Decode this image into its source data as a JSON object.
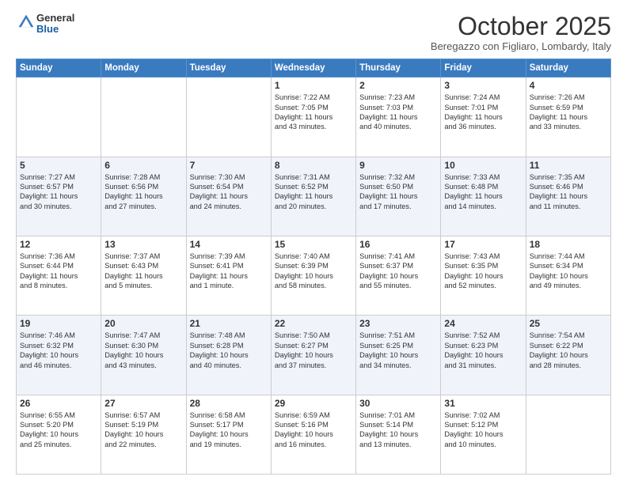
{
  "header": {
    "logo_line1": "General",
    "logo_line2": "Blue",
    "month": "October 2025",
    "location": "Beregazzo con Figliaro, Lombardy, Italy"
  },
  "weekdays": [
    "Sunday",
    "Monday",
    "Tuesday",
    "Wednesday",
    "Thursday",
    "Friday",
    "Saturday"
  ],
  "weeks": [
    [
      {
        "day": "",
        "info": ""
      },
      {
        "day": "",
        "info": ""
      },
      {
        "day": "",
        "info": ""
      },
      {
        "day": "1",
        "info": "Sunrise: 7:22 AM\nSunset: 7:05 PM\nDaylight: 11 hours\nand 43 minutes."
      },
      {
        "day": "2",
        "info": "Sunrise: 7:23 AM\nSunset: 7:03 PM\nDaylight: 11 hours\nand 40 minutes."
      },
      {
        "day": "3",
        "info": "Sunrise: 7:24 AM\nSunset: 7:01 PM\nDaylight: 11 hours\nand 36 minutes."
      },
      {
        "day": "4",
        "info": "Sunrise: 7:26 AM\nSunset: 6:59 PM\nDaylight: 11 hours\nand 33 minutes."
      }
    ],
    [
      {
        "day": "5",
        "info": "Sunrise: 7:27 AM\nSunset: 6:57 PM\nDaylight: 11 hours\nand 30 minutes."
      },
      {
        "day": "6",
        "info": "Sunrise: 7:28 AM\nSunset: 6:56 PM\nDaylight: 11 hours\nand 27 minutes."
      },
      {
        "day": "7",
        "info": "Sunrise: 7:30 AM\nSunset: 6:54 PM\nDaylight: 11 hours\nand 24 minutes."
      },
      {
        "day": "8",
        "info": "Sunrise: 7:31 AM\nSunset: 6:52 PM\nDaylight: 11 hours\nand 20 minutes."
      },
      {
        "day": "9",
        "info": "Sunrise: 7:32 AM\nSunset: 6:50 PM\nDaylight: 11 hours\nand 17 minutes."
      },
      {
        "day": "10",
        "info": "Sunrise: 7:33 AM\nSunset: 6:48 PM\nDaylight: 11 hours\nand 14 minutes."
      },
      {
        "day": "11",
        "info": "Sunrise: 7:35 AM\nSunset: 6:46 PM\nDaylight: 11 hours\nand 11 minutes."
      }
    ],
    [
      {
        "day": "12",
        "info": "Sunrise: 7:36 AM\nSunset: 6:44 PM\nDaylight: 11 hours\nand 8 minutes."
      },
      {
        "day": "13",
        "info": "Sunrise: 7:37 AM\nSunset: 6:43 PM\nDaylight: 11 hours\nand 5 minutes."
      },
      {
        "day": "14",
        "info": "Sunrise: 7:39 AM\nSunset: 6:41 PM\nDaylight: 11 hours\nand 1 minute."
      },
      {
        "day": "15",
        "info": "Sunrise: 7:40 AM\nSunset: 6:39 PM\nDaylight: 10 hours\nand 58 minutes."
      },
      {
        "day": "16",
        "info": "Sunrise: 7:41 AM\nSunset: 6:37 PM\nDaylight: 10 hours\nand 55 minutes."
      },
      {
        "day": "17",
        "info": "Sunrise: 7:43 AM\nSunset: 6:35 PM\nDaylight: 10 hours\nand 52 minutes."
      },
      {
        "day": "18",
        "info": "Sunrise: 7:44 AM\nSunset: 6:34 PM\nDaylight: 10 hours\nand 49 minutes."
      }
    ],
    [
      {
        "day": "19",
        "info": "Sunrise: 7:46 AM\nSunset: 6:32 PM\nDaylight: 10 hours\nand 46 minutes."
      },
      {
        "day": "20",
        "info": "Sunrise: 7:47 AM\nSunset: 6:30 PM\nDaylight: 10 hours\nand 43 minutes."
      },
      {
        "day": "21",
        "info": "Sunrise: 7:48 AM\nSunset: 6:28 PM\nDaylight: 10 hours\nand 40 minutes."
      },
      {
        "day": "22",
        "info": "Sunrise: 7:50 AM\nSunset: 6:27 PM\nDaylight: 10 hours\nand 37 minutes."
      },
      {
        "day": "23",
        "info": "Sunrise: 7:51 AM\nSunset: 6:25 PM\nDaylight: 10 hours\nand 34 minutes."
      },
      {
        "day": "24",
        "info": "Sunrise: 7:52 AM\nSunset: 6:23 PM\nDaylight: 10 hours\nand 31 minutes."
      },
      {
        "day": "25",
        "info": "Sunrise: 7:54 AM\nSunset: 6:22 PM\nDaylight: 10 hours\nand 28 minutes."
      }
    ],
    [
      {
        "day": "26",
        "info": "Sunrise: 6:55 AM\nSunset: 5:20 PM\nDaylight: 10 hours\nand 25 minutes."
      },
      {
        "day": "27",
        "info": "Sunrise: 6:57 AM\nSunset: 5:19 PM\nDaylight: 10 hours\nand 22 minutes."
      },
      {
        "day": "28",
        "info": "Sunrise: 6:58 AM\nSunset: 5:17 PM\nDaylight: 10 hours\nand 19 minutes."
      },
      {
        "day": "29",
        "info": "Sunrise: 6:59 AM\nSunset: 5:16 PM\nDaylight: 10 hours\nand 16 minutes."
      },
      {
        "day": "30",
        "info": "Sunrise: 7:01 AM\nSunset: 5:14 PM\nDaylight: 10 hours\nand 13 minutes."
      },
      {
        "day": "31",
        "info": "Sunrise: 7:02 AM\nSunset: 5:12 PM\nDaylight: 10 hours\nand 10 minutes."
      },
      {
        "day": "",
        "info": ""
      }
    ]
  ]
}
